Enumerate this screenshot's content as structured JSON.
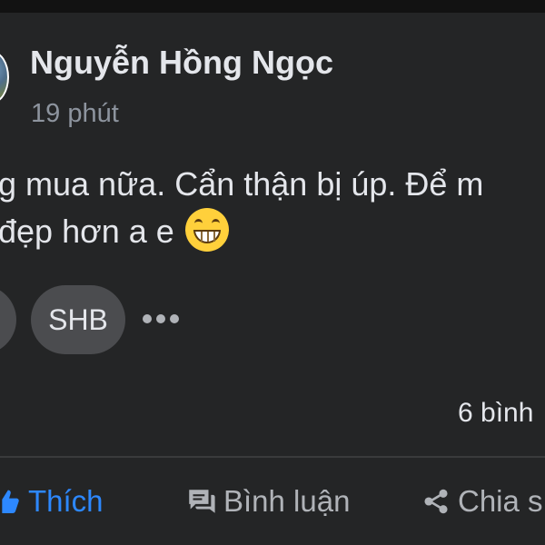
{
  "post": {
    "author": "Nguyễn Hồng Ngọc",
    "time": "19 phút",
    "text_line1": "g mua nữa. Cẩn thận bị úp. Để m",
    "text_line2": "đẹp hơn a e",
    "emoji": "grinning-face-with-smiling-eyes"
  },
  "tags": {
    "items": [
      "SHB"
    ]
  },
  "stats": {
    "comments": "6 bình"
  },
  "actions": {
    "like": "Thích",
    "comment": "Bình luận",
    "share": "Chia s"
  },
  "colors": {
    "background": "#242526",
    "primary_text": "#e4e6eb",
    "secondary_text": "#8d949e",
    "pill": "#4b4c4f",
    "like_blue": "#2d88ff",
    "icon_gray": "#b0b3b8"
  }
}
